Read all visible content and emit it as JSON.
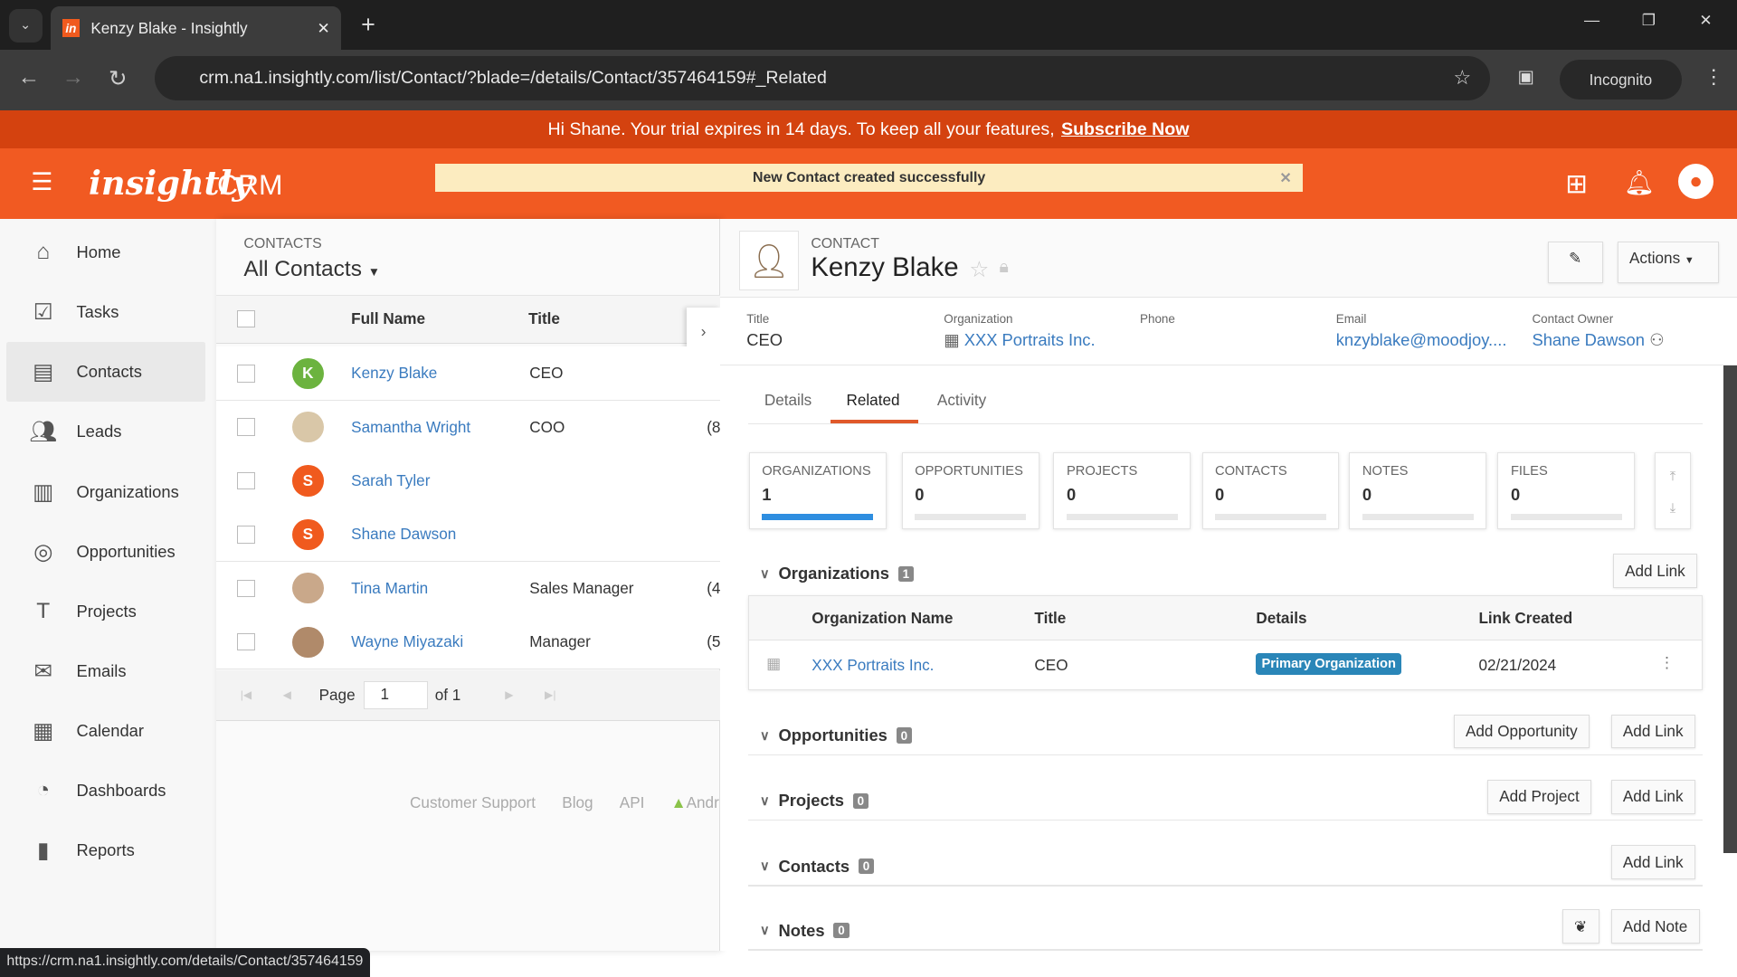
{
  "browser": {
    "tab_title": "Kenzy Blake - Insightly",
    "url": "crm.na1.insightly.com/list/Contact/?blade=/details/Contact/357464159#_Related",
    "incognito": "Incognito",
    "status_url": "https://crm.na1.insightly.com/details/Contact/357464159"
  },
  "trial": {
    "text": "Hi Shane. Your trial expires in 14 days. To keep all your features,",
    "link": "Subscribe Now"
  },
  "header": {
    "logo": "insightly",
    "product": "CRM",
    "toast": "New Contact created successfully"
  },
  "colors": {
    "brand": "#f15a22",
    "link": "#3a7bbf",
    "badge": "#2a86b8"
  },
  "sidebar": {
    "items": [
      {
        "label": "Home",
        "icon": "home-icon"
      },
      {
        "label": "Tasks",
        "icon": "tasks-icon"
      },
      {
        "label": "Contacts",
        "icon": "contacts-icon",
        "active": true
      },
      {
        "label": "Leads",
        "icon": "leads-icon"
      },
      {
        "label": "Organizations",
        "icon": "organizations-icon"
      },
      {
        "label": "Opportunities",
        "icon": "opportunities-icon"
      },
      {
        "label": "Projects",
        "icon": "projects-icon"
      },
      {
        "label": "Emails",
        "icon": "emails-icon"
      },
      {
        "label": "Calendar",
        "icon": "calendar-icon"
      },
      {
        "label": "Dashboards",
        "icon": "dashboards-icon"
      },
      {
        "label": "Reports",
        "icon": "reports-icon"
      }
    ]
  },
  "list": {
    "section": "CONTACTS",
    "view": "All Contacts",
    "columns": [
      "Full Name",
      "Title"
    ],
    "rows": [
      {
        "initial": "K",
        "color": "#6cb33f",
        "name": "Kenzy Blake",
        "title": "CEO",
        "extra": ""
      },
      {
        "initial": "",
        "color": "#d9c7a8",
        "name": "Samantha Wright",
        "title": "COO",
        "extra": "(8"
      },
      {
        "initial": "S",
        "color": "#f05a1e",
        "name": "Sarah Tyler",
        "title": "",
        "extra": ""
      },
      {
        "initial": "S",
        "color": "#f05a1e",
        "name": "Shane Dawson",
        "title": "",
        "extra": ""
      },
      {
        "initial": "",
        "color": "#c9a88a",
        "name": "Tina Martin",
        "title": "Sales Manager",
        "extra": "(4"
      },
      {
        "initial": "",
        "color": "#b08a6a",
        "name": "Wayne Miyazaki",
        "title": "Manager",
        "extra": "(5"
      }
    ],
    "pager": {
      "page_label": "Page",
      "page": "1",
      "of": "of 1"
    },
    "footer": [
      "Customer Support",
      "Blog",
      "API",
      "Andr"
    ]
  },
  "contact": {
    "type": "CONTACT",
    "name": "Kenzy Blake",
    "actions": "Actions",
    "fields": [
      {
        "label": "Title",
        "value": "CEO"
      },
      {
        "label": "Organization",
        "value": "XXX Portraits Inc."
      },
      {
        "label": "Phone",
        "value": ""
      },
      {
        "label": "Email",
        "value": "knzyblake@moodjoy...."
      },
      {
        "label": "Contact Owner",
        "value": "Shane Dawson"
      }
    ],
    "tabs": [
      "Details",
      "Related",
      "Activity"
    ],
    "active_tab": "Related",
    "cards": [
      {
        "label": "ORGANIZATIONS",
        "count": "1"
      },
      {
        "label": "OPPORTUNITIES",
        "count": "0"
      },
      {
        "label": "PROJECTS",
        "count": "0"
      },
      {
        "label": "CONTACTS",
        "count": "0"
      },
      {
        "label": "NOTES",
        "count": "0"
      },
      {
        "label": "FILES",
        "count": "0"
      }
    ],
    "orgs": {
      "title": "Organizations",
      "count": "1",
      "add_link": "Add Link",
      "columns": [
        "Organization Name",
        "Title",
        "Details",
        "Link Created"
      ],
      "row": {
        "name": "XXX Portraits Inc.",
        "title": "CEO",
        "details": "Primary Organization",
        "created": "02/21/2024"
      }
    },
    "sections": [
      {
        "title": "Opportunities",
        "count": "0",
        "buttons": [
          "Add Opportunity",
          "Add Link"
        ]
      },
      {
        "title": "Projects",
        "count": "0",
        "buttons": [
          "Add Project",
          "Add Link"
        ]
      },
      {
        "title": "Contacts",
        "count": "0",
        "buttons": [
          "Add Link"
        ]
      },
      {
        "title": "Notes",
        "count": "0",
        "buttons": [
          "Add Note"
        ]
      }
    ]
  }
}
